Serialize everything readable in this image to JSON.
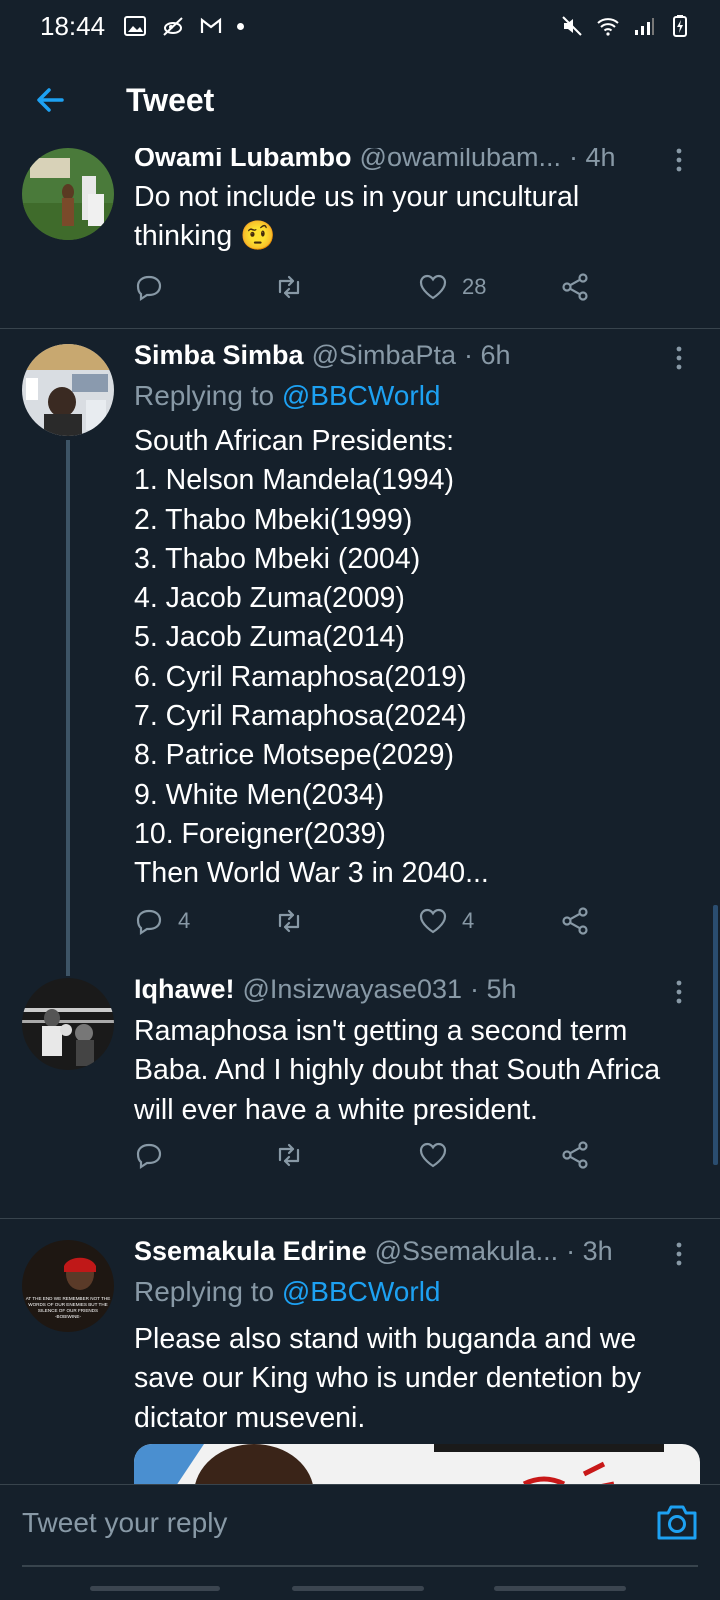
{
  "status_bar": {
    "time": "18:44"
  },
  "header": {
    "title": "Tweet"
  },
  "tweets": [
    {
      "name": "Owami Lubambo",
      "handle": "@owamilubam...",
      "time": "· 4h",
      "lines": [
        "Do not include us in your uncultural",
        "thinking 🤨"
      ],
      "reply_count": "",
      "like_count": "28"
    },
    {
      "name": "Simba Simba",
      "handle": "@SimbaPta",
      "time": "· 6h",
      "replying_prefix": "Replying to",
      "replying_to": "@BBCWorld",
      "lines": [
        "South African Presidents:",
        "1. Nelson Mandela(1994)",
        "2. Thabo Mbeki(1999)",
        "3. Thabo Mbeki (2004)",
        "4. Jacob Zuma(2009)",
        "5. Jacob Zuma(2014)",
        "6. Cyril Ramaphosa(2019)",
        "7. Cyril Ramaphosa(2024)",
        "8. Patrice Motsepe(2029)",
        "9. White Men(2034)",
        "10. Foreigner(2039)",
        "Then World War 3 in 2040..."
      ],
      "reply_count": "4",
      "like_count": "4"
    },
    {
      "name": "Iqhawe!",
      "handle": "@Insizwayase031",
      "time": "· 5h",
      "lines": [
        "Ramaphosa isn't getting a second term",
        "Baba. And I highly doubt that South Africa",
        "will ever have a white president."
      ],
      "reply_count": "",
      "like_count": ""
    },
    {
      "name": "Ssemakula Edrine",
      "handle": "@Ssemakula...",
      "time": "· 3h",
      "replying_prefix": "Replying to",
      "replying_to": "@BBCWorld",
      "lines": [
        "Please also stand with buganda and we",
        "save our King who is under dentetion by",
        "dictator museveni."
      ],
      "avatar_caption": "AT THE END WE REMEMBER NOT THE WORDS OF OUR ENEMIES BUT THE SILENCE OF OUR FRIENDS -BOBIWINE-"
    }
  ],
  "reply_bar": {
    "placeholder": "Tweet your reply"
  },
  "colors": {
    "background": "#15202b",
    "accent": "#1da1f2",
    "muted": "#8899a6",
    "divider": "#38444d"
  }
}
